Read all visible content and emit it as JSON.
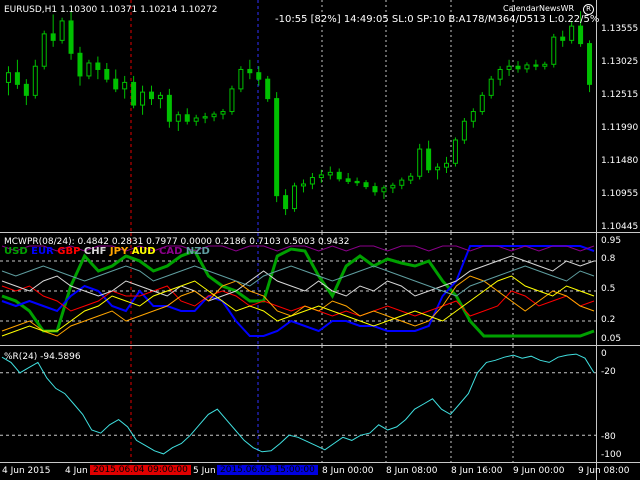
{
  "main": {
    "symbol_info": "EURUSD,H1  1.10300 1.10371 1.10214 1.10272",
    "status_line": "-10:55 [82%] 14:49:05 SL:0 SP:10 B:A178/M364/D513 L:0.22/5%",
    "calendar_label": "CalendarNewsWR",
    "y_labels": [
      "1.13555",
      "1.13025",
      "1.12515",
      "1.11990",
      "1.11480",
      "1.10955",
      "1.10445"
    ],
    "candles": [
      {
        "o": 1.1265,
        "h": 1.129,
        "l": 1.1245,
        "c": 1.128
      },
      {
        "o": 1.128,
        "h": 1.13,
        "l": 1.1255,
        "c": 1.1262
      },
      {
        "o": 1.1262,
        "h": 1.127,
        "l": 1.123,
        "c": 1.1245
      },
      {
        "o": 1.1245,
        "h": 1.13,
        "l": 1.124,
        "c": 1.129
      },
      {
        "o": 1.129,
        "h": 1.1345,
        "l": 1.1285,
        "c": 1.134
      },
      {
        "o": 1.134,
        "h": 1.137,
        "l": 1.132,
        "c": 1.133
      },
      {
        "o": 1.133,
        "h": 1.1365,
        "l": 1.1325,
        "c": 1.136
      },
      {
        "o": 1.136,
        "h": 1.1375,
        "l": 1.13,
        "c": 1.131
      },
      {
        "o": 1.131,
        "h": 1.132,
        "l": 1.126,
        "c": 1.1275
      },
      {
        "o": 1.1275,
        "h": 1.13,
        "l": 1.127,
        "c": 1.1295
      },
      {
        "o": 1.1295,
        "h": 1.1305,
        "l": 1.127,
        "c": 1.1285
      },
      {
        "o": 1.1285,
        "h": 1.1295,
        "l": 1.1265,
        "c": 1.127
      },
      {
        "o": 1.127,
        "h": 1.1285,
        "l": 1.125,
        "c": 1.1255
      },
      {
        "o": 1.1255,
        "h": 1.1275,
        "l": 1.124,
        "c": 1.1265
      },
      {
        "o": 1.1265,
        "h": 1.1275,
        "l": 1.1225,
        "c": 1.123
      },
      {
        "o": 1.123,
        "h": 1.126,
        "l": 1.1215,
        "c": 1.125
      },
      {
        "o": 1.125,
        "h": 1.126,
        "l": 1.123,
        "c": 1.124
      },
      {
        "o": 1.124,
        "h": 1.125,
        "l": 1.1225,
        "c": 1.1245
      },
      {
        "o": 1.1245,
        "h": 1.1255,
        "l": 1.1195,
        "c": 1.1205
      },
      {
        "o": 1.1205,
        "h": 1.122,
        "l": 1.119,
        "c": 1.1215
      },
      {
        "o": 1.1215,
        "h": 1.1225,
        "l": 1.12,
        "c": 1.1205
      },
      {
        "o": 1.1205,
        "h": 1.1215,
        "l": 1.1198,
        "c": 1.121
      },
      {
        "o": 1.121,
        "h": 1.1218,
        "l": 1.1202,
        "c": 1.1212
      },
      {
        "o": 1.1212,
        "h": 1.122,
        "l": 1.1205,
        "c": 1.1216
      },
      {
        "o": 1.1216,
        "h": 1.1224,
        "l": 1.1208,
        "c": 1.122
      },
      {
        "o": 1.122,
        "h": 1.126,
        "l": 1.1215,
        "c": 1.1255
      },
      {
        "o": 1.1255,
        "h": 1.129,
        "l": 1.125,
        "c": 1.1285
      },
      {
        "o": 1.1285,
        "h": 1.13,
        "l": 1.127,
        "c": 1.128
      },
      {
        "o": 1.128,
        "h": 1.129,
        "l": 1.126,
        "c": 1.127
      },
      {
        "o": 1.127,
        "h": 1.1275,
        "l": 1.1235,
        "c": 1.124
      },
      {
        "o": 1.124,
        "h": 1.125,
        "l": 1.108,
        "c": 1.109
      },
      {
        "o": 1.109,
        "h": 1.11,
        "l": 1.106,
        "c": 1.107
      },
      {
        "o": 1.107,
        "h": 1.111,
        "l": 1.1065,
        "c": 1.1105
      },
      {
        "o": 1.1105,
        "h": 1.1115,
        "l": 1.1095,
        "c": 1.1108
      },
      {
        "o": 1.1108,
        "h": 1.1125,
        "l": 1.11,
        "c": 1.1118
      },
      {
        "o": 1.1118,
        "h": 1.113,
        "l": 1.111,
        "c": 1.1122
      },
      {
        "o": 1.1122,
        "h": 1.1135,
        "l": 1.1115,
        "c": 1.1126
      },
      {
        "o": 1.1126,
        "h": 1.1132,
        "l": 1.1112,
        "c": 1.1116
      },
      {
        "o": 1.1116,
        "h": 1.1125,
        "l": 1.1108,
        "c": 1.1112
      },
      {
        "o": 1.1112,
        "h": 1.1118,
        "l": 1.1105,
        "c": 1.111
      },
      {
        "o": 1.111,
        "h": 1.1114,
        "l": 1.11,
        "c": 1.1104
      },
      {
        "o": 1.1104,
        "h": 1.111,
        "l": 1.109,
        "c": 1.1096
      },
      {
        "o": 1.1096,
        "h": 1.1106,
        "l": 1.1085,
        "c": 1.1102
      },
      {
        "o": 1.1102,
        "h": 1.111,
        "l": 1.1094,
        "c": 1.1106
      },
      {
        "o": 1.1106,
        "h": 1.1118,
        "l": 1.11,
        "c": 1.1114
      },
      {
        "o": 1.1114,
        "h": 1.1125,
        "l": 1.1108,
        "c": 1.112
      },
      {
        "o": 1.112,
        "h": 1.117,
        "l": 1.1115,
        "c": 1.1162
      },
      {
        "o": 1.1162,
        "h": 1.1175,
        "l": 1.1125,
        "c": 1.113
      },
      {
        "o": 1.113,
        "h": 1.114,
        "l": 1.1115,
        "c": 1.1134
      },
      {
        "o": 1.1134,
        "h": 1.115,
        "l": 1.1125,
        "c": 1.114
      },
      {
        "o": 1.114,
        "h": 1.118,
        "l": 1.1135,
        "c": 1.1176
      },
      {
        "o": 1.1176,
        "h": 1.121,
        "l": 1.117,
        "c": 1.1205
      },
      {
        "o": 1.1205,
        "h": 1.1225,
        "l": 1.1195,
        "c": 1.122
      },
      {
        "o": 1.122,
        "h": 1.125,
        "l": 1.1215,
        "c": 1.1245
      },
      {
        "o": 1.1245,
        "h": 1.1275,
        "l": 1.124,
        "c": 1.127
      },
      {
        "o": 1.127,
        "h": 1.129,
        "l": 1.126,
        "c": 1.1285
      },
      {
        "o": 1.1285,
        "h": 1.13,
        "l": 1.1275,
        "c": 1.129
      },
      {
        "o": 1.129,
        "h": 1.1298,
        "l": 1.128,
        "c": 1.1286
      },
      {
        "o": 1.1286,
        "h": 1.1296,
        "l": 1.128,
        "c": 1.1292
      },
      {
        "o": 1.1292,
        "h": 1.13,
        "l": 1.1284,
        "c": 1.129
      },
      {
        "o": 1.129,
        "h": 1.1297,
        "l": 1.1285,
        "c": 1.1293
      },
      {
        "o": 1.1293,
        "h": 1.134,
        "l": 1.1288,
        "c": 1.1335
      },
      {
        "o": 1.1335,
        "h": 1.1345,
        "l": 1.132,
        "c": 1.133
      },
      {
        "o": 1.133,
        "h": 1.136,
        "l": 1.1325,
        "c": 1.1352
      },
      {
        "o": 1.1352,
        "h": 1.1375,
        "l": 1.132,
        "c": 1.1325
      },
      {
        "o": 1.1325,
        "h": 1.133,
        "l": 1.125,
        "c": 1.1262
      }
    ]
  },
  "mcwpr": {
    "header": "MCWPR(08/24): 0.4842 0.2831 0.7977 0.0000 0.2186 0.7103 0.5003 0.9432",
    "legend": [
      {
        "name": "USD",
        "color": "#00a000"
      },
      {
        "name": "EUR",
        "color": "#0000ff"
      },
      {
        "name": "GBP",
        "color": "#ff0000"
      },
      {
        "name": "CHF",
        "color": "#d8d8d8"
      },
      {
        "name": "JPY",
        "color": "#ffa500"
      },
      {
        "name": "AUD",
        "color": "#ffff00"
      },
      {
        "name": "CAD",
        "color": "#8b008b"
      },
      {
        "name": "NZD",
        "color": "#5f9ea0"
      }
    ],
    "y_labels": [
      "0.95",
      "0.8",
      "0.5",
      "0.2",
      "0.05"
    ],
    "series": [
      {
        "name": "USD",
        "color": "#00a000",
        "width": 3,
        "values": [
          0.45,
          0.4,
          0.3,
          0.1,
          0.1,
          0.55,
          0.85,
          0.7,
          0.75,
          0.85,
          0.8,
          0.7,
          0.75,
          0.85,
          0.9,
          0.65,
          0.55,
          0.5,
          0.4,
          0.4,
          0.85,
          0.92,
          0.9,
          0.65,
          0.45,
          0.75,
          0.85,
          0.75,
          0.82,
          0.78,
          0.75,
          0.8,
          0.6,
          0.45,
          0.2,
          0.05,
          0.05,
          0.05,
          0.05,
          0.05,
          0.05,
          0.05,
          0.05,
          0.1
        ]
      },
      {
        "name": "EUR",
        "color": "#0000ff",
        "width": 2,
        "values": [
          0.4,
          0.35,
          0.4,
          0.35,
          0.3,
          0.45,
          0.55,
          0.5,
          0.35,
          0.3,
          0.5,
          0.35,
          0.35,
          0.3,
          0.3,
          0.45,
          0.4,
          0.2,
          0.05,
          0.05,
          0.1,
          0.2,
          0.15,
          0.1,
          0.2,
          0.2,
          0.15,
          0.15,
          0.1,
          0.1,
          0.1,
          0.15,
          0.45,
          0.6,
          0.95,
          0.95,
          0.95,
          0.95,
          0.95,
          0.95,
          0.95,
          0.95,
          0.95,
          0.9
        ]
      },
      {
        "name": "GBP",
        "color": "#ff0000",
        "width": 1,
        "values": [
          0.55,
          0.5,
          0.55,
          0.45,
          0.4,
          0.3,
          0.35,
          0.4,
          0.5,
          0.45,
          0.45,
          0.5,
          0.55,
          0.4,
          0.35,
          0.45,
          0.5,
          0.45,
          0.35,
          0.4,
          0.35,
          0.3,
          0.35,
          0.3,
          0.25,
          0.3,
          0.25,
          0.3,
          0.35,
          0.3,
          0.25,
          0.3,
          0.35,
          0.4,
          0.25,
          0.3,
          0.35,
          0.5,
          0.45,
          0.35,
          0.4,
          0.45,
          0.35,
          0.4
        ]
      },
      {
        "name": "CHF",
        "color": "#d8d8d8",
        "width": 1,
        "values": [
          0.6,
          0.55,
          0.5,
          0.6,
          0.65,
          0.55,
          0.5,
          0.45,
          0.5,
          0.6,
          0.55,
          0.5,
          0.45,
          0.55,
          0.5,
          0.4,
          0.45,
          0.5,
          0.6,
          0.7,
          0.6,
          0.55,
          0.5,
          0.6,
          0.5,
          0.45,
          0.55,
          0.5,
          0.6,
          0.55,
          0.45,
          0.5,
          0.55,
          0.6,
          0.7,
          0.75,
          0.8,
          0.85,
          0.8,
          0.75,
          0.7,
          0.8,
          0.75,
          0.8
        ]
      },
      {
        "name": "JPY",
        "color": "#ffa500",
        "width": 1,
        "values": [
          0.1,
          0.15,
          0.2,
          0.1,
          0.05,
          0.15,
          0.2,
          0.25,
          0.3,
          0.2,
          0.25,
          0.3,
          0.35,
          0.45,
          0.5,
          0.4,
          0.55,
          0.6,
          0.5,
          0.45,
          0.3,
          0.25,
          0.35,
          0.3,
          0.4,
          0.35,
          0.25,
          0.3,
          0.25,
          0.2,
          0.15,
          0.2,
          0.35,
          0.55,
          0.65,
          0.6,
          0.5,
          0.4,
          0.3,
          0.4,
          0.5,
          0.45,
          0.35,
          0.3
        ]
      },
      {
        "name": "AUD",
        "color": "#ffff00",
        "width": 1,
        "values": [
          0.05,
          0.1,
          0.15,
          0.1,
          0.1,
          0.2,
          0.3,
          0.35,
          0.45,
          0.4,
          0.35,
          0.45,
          0.5,
          0.55,
          0.6,
          0.5,
          0.4,
          0.3,
          0.35,
          0.3,
          0.2,
          0.25,
          0.3,
          0.35,
          0.3,
          0.25,
          0.2,
          0.15,
          0.2,
          0.25,
          0.3,
          0.25,
          0.2,
          0.3,
          0.4,
          0.5,
          0.6,
          0.65,
          0.55,
          0.5,
          0.45,
          0.55,
          0.5,
          0.45
        ]
      },
      {
        "name": "CAD",
        "color": "#8b008b",
        "width": 1,
        "values": [
          0.95,
          0.9,
          0.95,
          0.95,
          0.9,
          0.95,
          0.9,
          0.95,
          0.95,
          0.9,
          0.95,
          0.9,
          0.95,
          0.95,
          0.9,
          0.95,
          0.95,
          0.9,
          0.95,
          0.95,
          0.9,
          0.95,
          0.95,
          0.9,
          0.95,
          0.9,
          0.95,
          0.95,
          0.9,
          0.95,
          0.95,
          0.9,
          0.95,
          0.95,
          0.9,
          0.95,
          0.95,
          0.9,
          0.95,
          0.9,
          0.95,
          0.95,
          0.9,
          0.95
        ]
      },
      {
        "name": "NZD",
        "color": "#5f9ea0",
        "width": 1,
        "values": [
          0.7,
          0.65,
          0.7,
          0.75,
          0.7,
          0.65,
          0.6,
          0.65,
          0.7,
          0.75,
          0.7,
          0.6,
          0.65,
          0.7,
          0.75,
          0.7,
          0.65,
          0.6,
          0.55,
          0.65,
          0.7,
          0.75,
          0.7,
          0.65,
          0.6,
          0.65,
          0.7,
          0.75,
          0.7,
          0.65,
          0.6,
          0.55,
          0.5,
          0.45,
          0.55,
          0.6,
          0.65,
          0.7,
          0.75,
          0.7,
          0.65,
          0.6,
          0.7,
          0.65
        ]
      }
    ]
  },
  "wpr": {
    "header": "%R(24) -94.5896",
    "y_labels": [
      "0",
      "-20",
      "-80",
      "-100"
    ],
    "values": [
      -5,
      -10,
      -20,
      -15,
      -10,
      -25,
      -35,
      -40,
      -50,
      -60,
      -75,
      -78,
      -70,
      -65,
      -72,
      -85,
      -90,
      -95,
      -98,
      -92,
      -88,
      -80,
      -70,
      -60,
      -55,
      -65,
      -75,
      -85,
      -92,
      -96,
      -95,
      -88,
      -80,
      -82,
      -86,
      -90,
      -94,
      -88,
      -82,
      -85,
      -80,
      -78,
      -70,
      -75,
      -72,
      -65,
      -55,
      -50,
      -45,
      -55,
      -60,
      -50,
      -40,
      -20,
      -10,
      -8,
      -5,
      -3,
      -6,
      -4,
      -8,
      -10,
      -5,
      -3,
      -2,
      -6,
      -20
    ]
  },
  "x_axis": {
    "labels": [
      {
        "text": "4 Jun 2015",
        "x": 2
      },
      {
        "text": "4 Jun",
        "x": 65
      },
      {
        "text": "5 Jun",
        "x": 193
      },
      {
        "text": "8 Jun 00:00",
        "x": 322
      },
      {
        "text": "8 Jun 08:00",
        "x": 386
      },
      {
        "text": "8 Jun 16:00",
        "x": 451
      },
      {
        "text": "9 Jun 00:00",
        "x": 513
      },
      {
        "text": "9 Jun 08:00",
        "x": 578
      }
    ],
    "markers": [
      {
        "text": "2015.06.04 09:00:00",
        "bg": "#e00000",
        "fg": "#000000"
      },
      {
        "text": "2015.06.05 15:00:00",
        "bg": "#0000e0",
        "fg": "#000000"
      }
    ]
  }
}
